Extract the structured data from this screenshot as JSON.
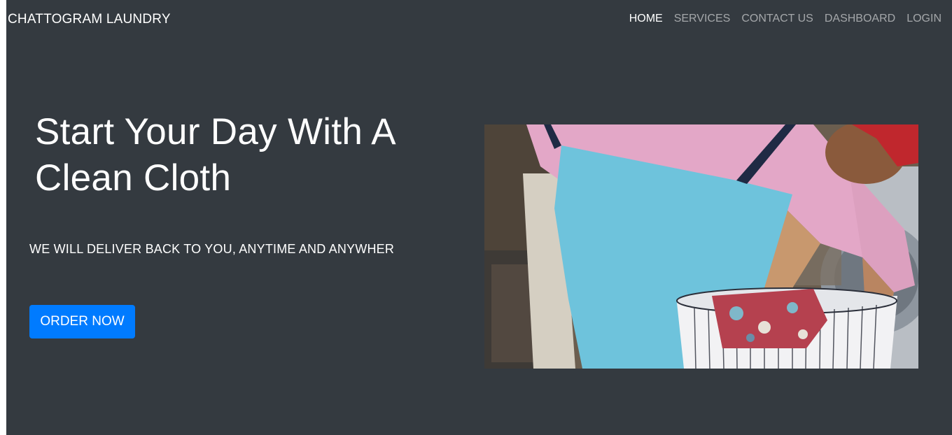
{
  "brand": {
    "name": "CHATTOGRAM LAUNDRY"
  },
  "nav": {
    "items": [
      {
        "label": "HOME",
        "active": true
      },
      {
        "label": "SERVICES",
        "active": false
      },
      {
        "label": "CONTACT US",
        "active": false
      },
      {
        "label": "DASHBOARD",
        "active": false
      },
      {
        "label": "LOGIN",
        "active": false
      }
    ]
  },
  "hero": {
    "headline": "Start Your Day With A Clean Cloth",
    "tagline": "WE WILL DELIVER BACK TO YOU, ANYTIME AND ANYWHER",
    "button_label": "ORDER NOW",
    "image_subject": "person-loading-laundry-photo"
  },
  "colors": {
    "page_background": "#343a40",
    "accent_button": "#007bff",
    "nav_inactive": "rgba(255,255,255,0.55)",
    "nav_active": "#ffffff"
  }
}
